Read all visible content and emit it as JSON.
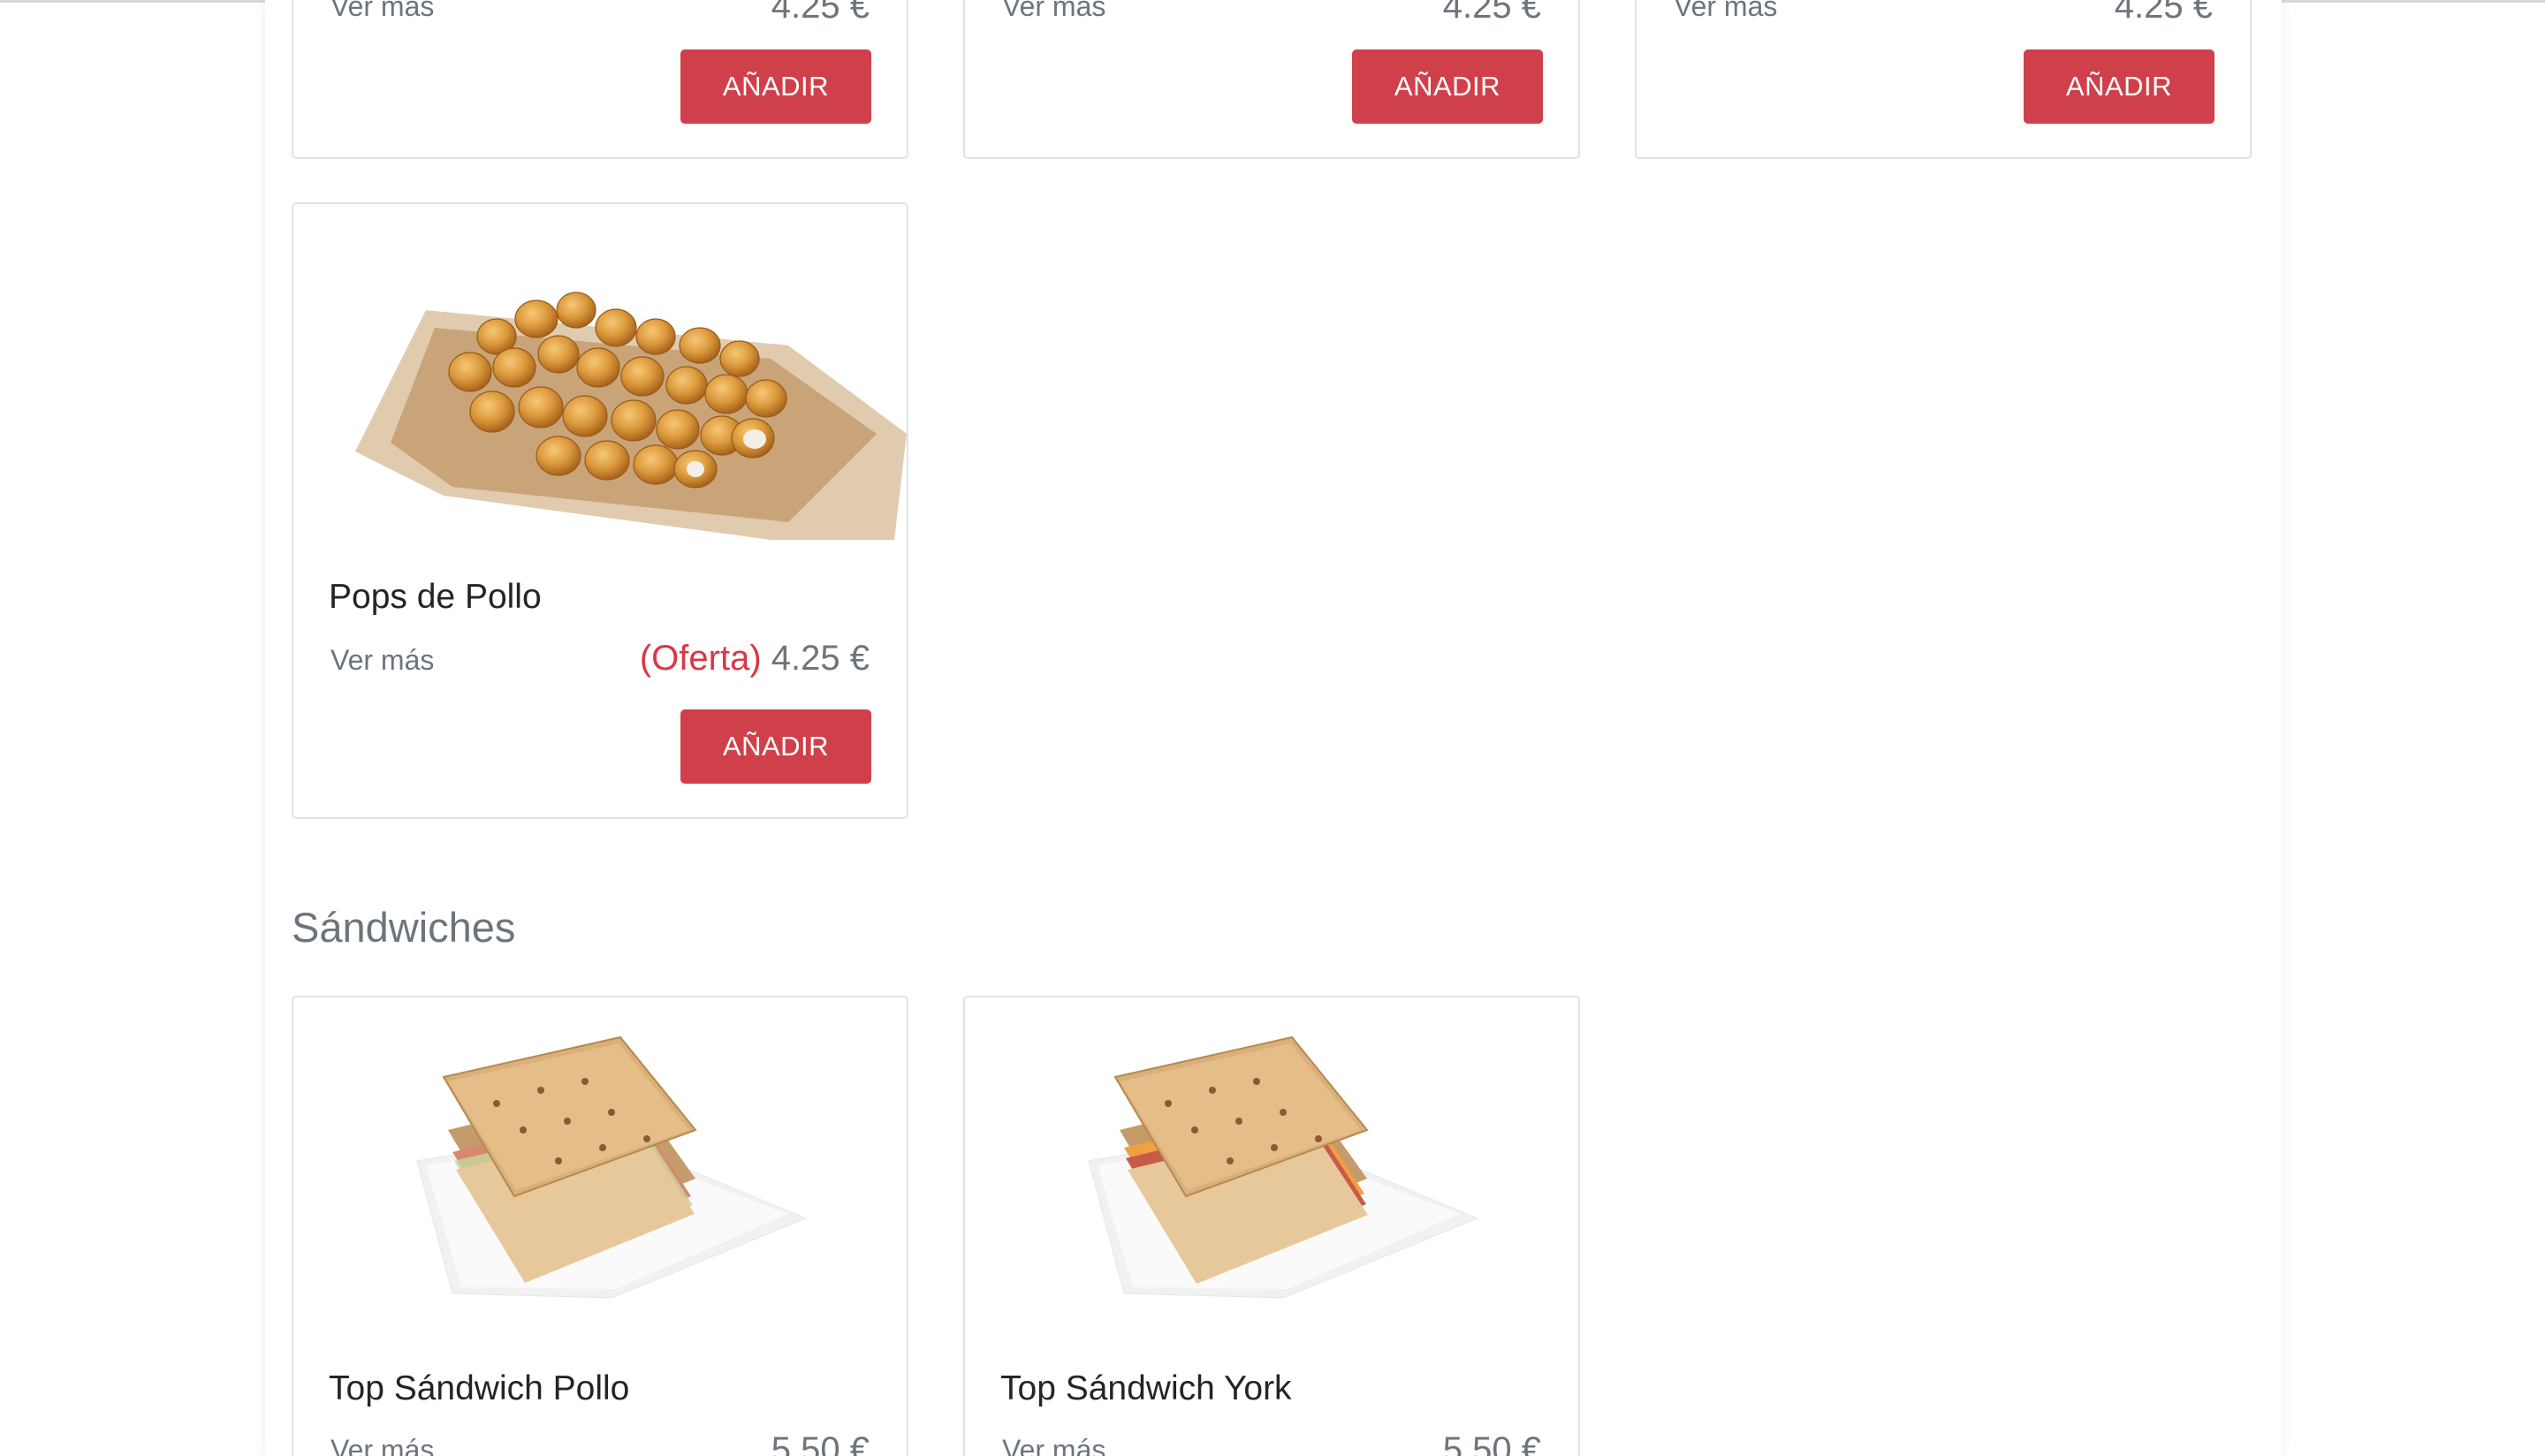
{
  "currency_note": "",
  "top_row": [
    {
      "ver_mas": "Ver más",
      "price": "4.25 €",
      "button": "AÑADIR"
    },
    {
      "ver_mas": "Ver más",
      "price": "4.25 €",
      "button": "AÑADIR"
    },
    {
      "ver_mas": "Ver más",
      "price": "4.25 €",
      "button": "AÑADIR"
    }
  ],
  "pops": {
    "title": "Pops de Pollo",
    "ver_mas": "Ver más",
    "offer_label": "(Oferta)",
    "price": "4.25 €",
    "button": "AÑADIR"
  },
  "sandwiches": {
    "heading": "Sándwiches",
    "items": [
      {
        "title": "Top Sándwich Pollo",
        "ver_mas": "Ver más",
        "price": "5.50 €"
      },
      {
        "title": "Top Sándwich York",
        "ver_mas": "Ver más",
        "price": "5.50 €"
      }
    ]
  },
  "colors": {
    "accent": "#d0404a",
    "offer": "#dc3545",
    "muted_text": "#6c757d",
    "title_text": "#212529",
    "card_border": "#dfe2e6"
  }
}
